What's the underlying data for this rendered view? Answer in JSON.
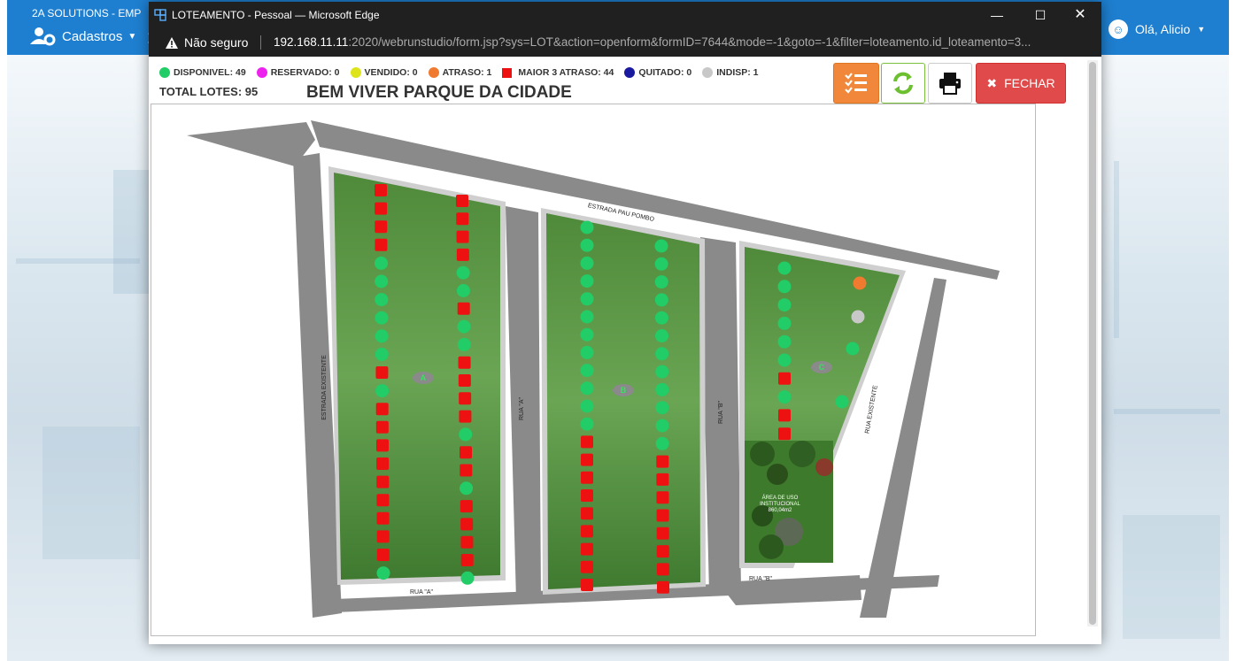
{
  "app": {
    "company": "2A SOLUTIONS - EMP",
    "menu_cadastros": "Cadastros",
    "user_greeting": "Olá, Alicio",
    "brand_color": "#1e7fd0"
  },
  "window": {
    "title": "LOTEAMENTO - Pessoal — Microsoft Edge",
    "not_secure": "Não seguro",
    "url_host": "192.168.11.11",
    "url_rest": ":2020/webrunstudio/form.jsp?sys=LOT&action=openform&formID=7644&mode=-1&goto=-1&filter=loteamento.id_loteamento=3..."
  },
  "legend": [
    {
      "label": "DISPONIVEL: 49",
      "shape": "circle",
      "color": "#22cc66"
    },
    {
      "label": "RESERVADO: 0",
      "shape": "circle",
      "color": "#ee22ee"
    },
    {
      "label": "VENDIDO: 0",
      "shape": "circle",
      "color": "#dde41a"
    },
    {
      "label": "ATRASO: 1",
      "shape": "circle",
      "color": "#f07a30"
    },
    {
      "label": "MAIOR 3 ATRASO: 44",
      "shape": "square",
      "color": "#ee1111"
    },
    {
      "label": "QUITADO: 0",
      "shape": "circle",
      "color": "#1a1aa0"
    },
    {
      "label": "INDISP: 1",
      "shape": "circle",
      "color": "#c8c8c8"
    }
  ],
  "total_lotes": "TOTAL LOTES: 95",
  "project_title": "BEM VIVER PARQUE DA CIDADE",
  "buttons": {
    "close": "FECHAR"
  },
  "map": {
    "roads": {
      "estrada_pau_pombo": "ESTRADA PAU POMBO",
      "estrada_existente": "ESTRADA EXISTENTE",
      "rua_existente": "RUA EXISTENTE",
      "rua_a": "RUA \"A\"",
      "rua_b": "RUA \"B\""
    },
    "blocks": {
      "a": "A",
      "b": "B",
      "c": "C"
    },
    "institutional_area": [
      "ÁREA DE USO",
      "INSTITUCIONAL",
      "860,04m2"
    ],
    "block_a": {
      "left": [
        "R",
        "R",
        "R",
        "R",
        "G",
        "G",
        "G",
        "G",
        "G",
        "G",
        "R",
        "G",
        "R",
        "R",
        "R",
        "R",
        "R",
        "R",
        "R",
        "R",
        "R",
        "G"
      ],
      "right": [
        "R",
        "R",
        "R",
        "R",
        "G",
        "G",
        "R",
        "G",
        "G",
        "R",
        "R",
        "R",
        "R",
        "G",
        "R",
        "R",
        "G",
        "R",
        "R",
        "R",
        "R",
        "G"
      ]
    },
    "block_b": {
      "left": [
        "G",
        "G",
        "G",
        "G",
        "G",
        "G",
        "G",
        "G",
        "G",
        "G",
        "G",
        "G",
        "R",
        "R",
        "R",
        "R",
        "R",
        "R",
        "R",
        "R",
        "R"
      ],
      "right": [
        "G",
        "G",
        "G",
        "G",
        "G",
        "G",
        "G",
        "G",
        "G",
        "G",
        "G",
        "G",
        "R",
        "R",
        "R",
        "R",
        "R",
        "R",
        "R",
        "R"
      ]
    },
    "block_c": {
      "left": [
        "G",
        "G",
        "G",
        "G",
        "G",
        "G",
        "R",
        "G",
        "R",
        "R"
      ],
      "right": [
        "O",
        "I",
        "G",
        "G"
      ]
    }
  }
}
